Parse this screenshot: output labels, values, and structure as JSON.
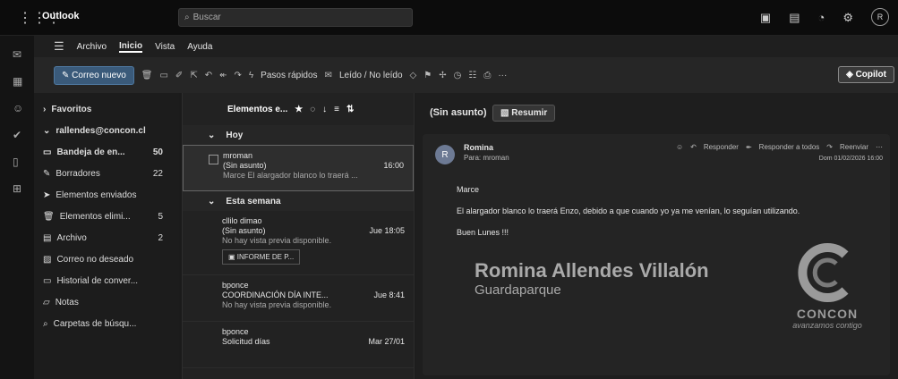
{
  "app": {
    "name": "Outlook"
  },
  "search": {
    "placeholder": "Buscar"
  },
  "avatar_initial": "R",
  "menu": {
    "tabs": [
      "Archivo",
      "Inicio",
      "Vista",
      "Ayuda"
    ],
    "active": "Inicio"
  },
  "ribbon": {
    "new_mail": "Correo nuevo",
    "quick_steps": "Pasos rápidos",
    "read_unread": "Leído / No leído",
    "more": "···",
    "copilot": "Copilot"
  },
  "folders": {
    "favorites": "Favoritos",
    "account": "rallendes@concon.cl",
    "items": [
      {
        "label": "Bandeja de en...",
        "count": "50",
        "icon": "inbox-icon"
      },
      {
        "label": "Borradores",
        "count": "22",
        "icon": "draft-icon"
      },
      {
        "label": "Elementos enviados",
        "count": "",
        "icon": "sent-icon"
      },
      {
        "label": "Elementos elimi...",
        "count": "5",
        "icon": "trash-icon"
      },
      {
        "label": "Archivo",
        "count": "2",
        "icon": "archive-icon"
      },
      {
        "label": "Correo no deseado",
        "count": "",
        "icon": "junk-icon"
      },
      {
        "label": "Historial de conver...",
        "count": "",
        "icon": "history-icon"
      },
      {
        "label": "Notas",
        "count": "",
        "icon": "notes-icon"
      },
      {
        "label": "Carpetas de búsqu...",
        "count": "",
        "icon": "search-folder-icon"
      }
    ]
  },
  "list": {
    "header": "Elementos e...",
    "groups": {
      "today": "Hoy",
      "this_week": "Esta semana"
    },
    "messages": [
      {
        "from": "mroman",
        "subject": "(Sin asunto)",
        "time": "16:00",
        "preview": "Marce El alargador blanco lo traerá ..."
      },
      {
        "from": "cllilo dimao",
        "subject": "(Sin asunto)",
        "time": "Jue 18:05",
        "preview": "No hay vista previa disponible.",
        "attachment": "INFORME DE P..."
      },
      {
        "from": "bponce",
        "subject": "COORDINACIÓN DÍA INTE...",
        "time": "Jue 8:41",
        "preview": "No hay vista previa disponible."
      },
      {
        "from": "bponce",
        "subject": "Solicitud días",
        "time": "Mar 27/01",
        "preview": ""
      }
    ]
  },
  "reading": {
    "subject": "(Sin asunto)",
    "summarize": "Resumir",
    "sender": "Romina",
    "to": "Para: mroman",
    "reply": "Responder",
    "reply_all": "Responder a todos",
    "forward": "Reenviar",
    "date": "Dom 01/02/2026 16:00",
    "body": [
      "Marce",
      "El alargador blanco lo traerá Enzo, debido a que cuando yo ya me venían, lo seguían utilizando.",
      "Buen Lunes !!!"
    ],
    "signature": {
      "name": "Romina Allendes Villalón",
      "title": "Guardaparque",
      "logo_text": "CONCON",
      "slogan": "avanzamos contigo"
    }
  }
}
